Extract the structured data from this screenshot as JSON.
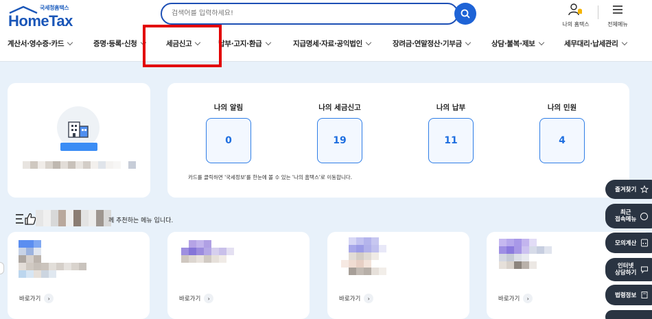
{
  "header": {
    "logo_sub": "국세청홈택스",
    "logo_main": "HomeTax",
    "search_placeholder": "검색어를 입력하세요!",
    "my_hometax": "나의 홈택스",
    "all_menu": "전체메뉴"
  },
  "nav": {
    "items": [
      "계산서·영수증·카드",
      "증명·등록·신청",
      "세금신고",
      "납부·고지·환급",
      "지급명세·자료·공익법인",
      "장려금·연말정산·기부금",
      "상담·불복·제보",
      "세무대리·납세관리"
    ]
  },
  "summary": {
    "stats": [
      {
        "title": "나의 알림",
        "value": "0"
      },
      {
        "title": "나의 세금신고",
        "value": "19"
      },
      {
        "title": "나의 납부",
        "value": "11"
      },
      {
        "title": "나의 민원",
        "value": "4"
      }
    ],
    "note": "카드를 클릭하면 '국세정보'를 한눈에 볼 수 있는 '나의 홈택스'로 이동합니다."
  },
  "recommend": {
    "suffix": "께 추천하는 메뉴 입니다."
  },
  "menu_cards": {
    "go_label": "바로가기"
  },
  "quick_menu": [
    {
      "label": "즐겨찾기"
    },
    {
      "label": "최근\n접속메뉴"
    },
    {
      "label": "모의계산"
    },
    {
      "label": "인터넷\n상담하기"
    },
    {
      "label": "법령정보"
    }
  ],
  "colors": {
    "brand": "#1a56b8",
    "accent": "#1f6fe0",
    "highlight": "#e20000",
    "background": "#e8f1fa"
  }
}
